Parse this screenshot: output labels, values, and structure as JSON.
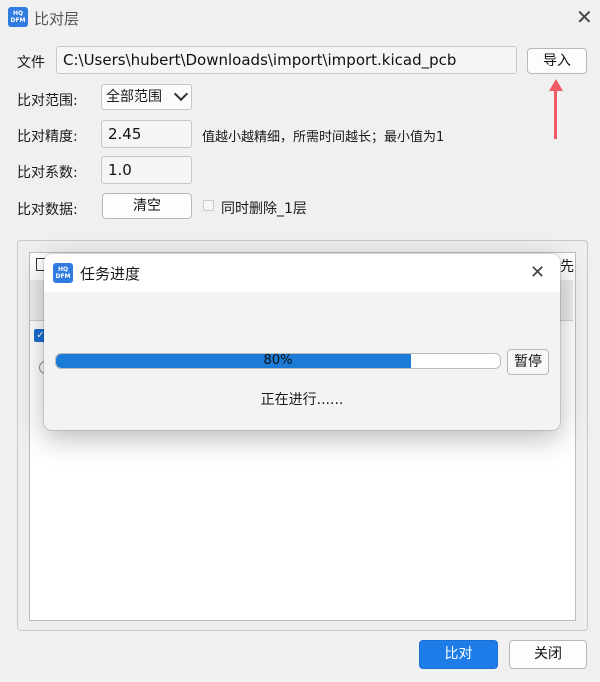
{
  "window": {
    "title": "比对层",
    "logo_text_top": "HQ",
    "logo_text_bottom": "DFM"
  },
  "form": {
    "file_label": "文件",
    "file_path": "C:\\Users\\hubert\\Downloads\\import\\import.kicad_pcb",
    "import_button": "导入",
    "range_label": "比对范围:",
    "range_value": "全部范围",
    "precision_label": "比对精度:",
    "precision_value": "2.45",
    "precision_hint": "值越小越精细，所需时间越长；最小值为1",
    "coef_label": "比对系数:",
    "coef_value": "1.0",
    "data_label": "比对数据:",
    "clear_button": "清空",
    "delete_checkbox_label": "同时删除_1层"
  },
  "background_panel": {
    "right_partial_text": "先"
  },
  "progress_dialog": {
    "title": "任务进度",
    "progress_percent": 80,
    "progress_label": "80%",
    "pause_button": "暂停",
    "status_text": "正在进行......"
  },
  "footer": {
    "compare_button": "比对",
    "close_button": "关闭"
  },
  "colors": {
    "accent": "#1e7ce8",
    "annotation_arrow": "#ef5a63"
  }
}
